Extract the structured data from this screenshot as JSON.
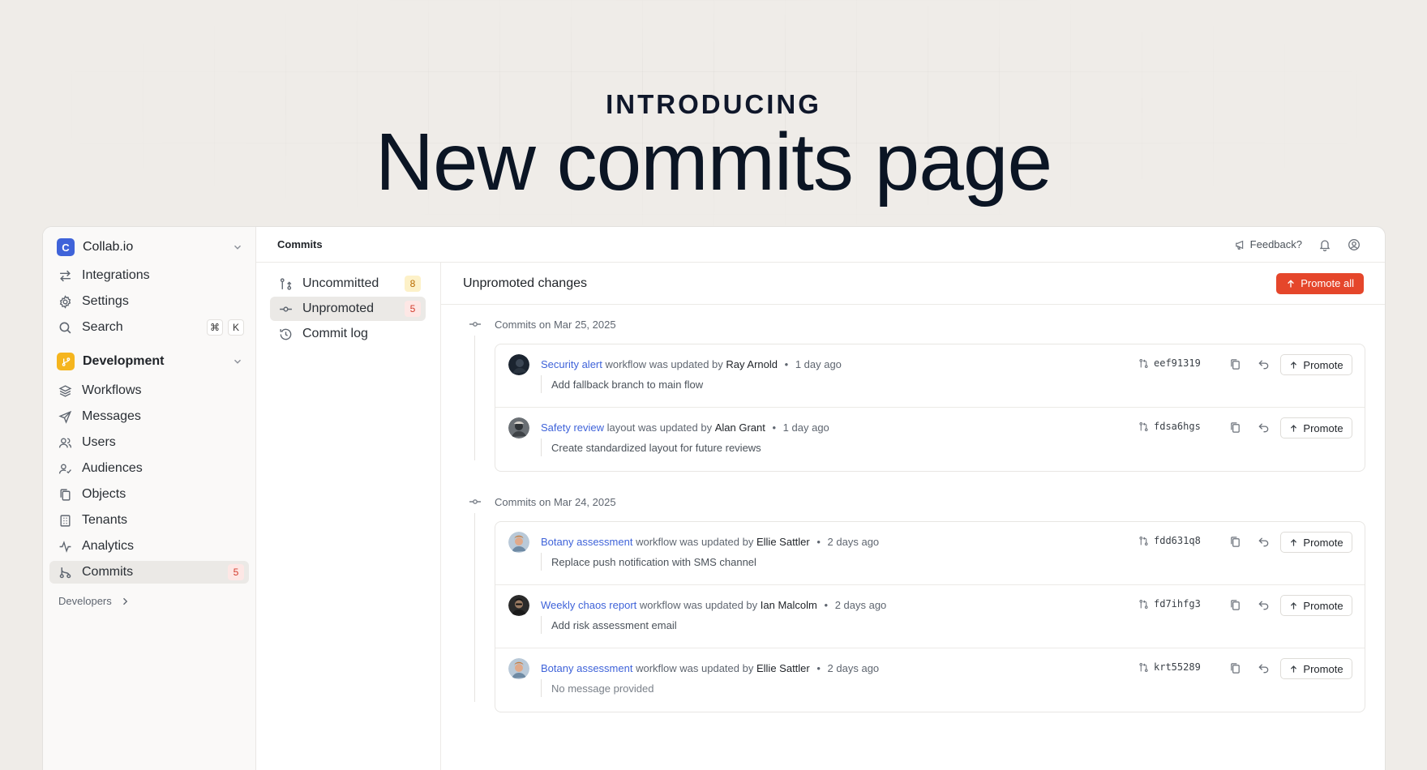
{
  "hero": {
    "kicker": "INTRODUCING",
    "title": "New commits page"
  },
  "sidebar": {
    "org_name": "Collab.io",
    "org_logo_letter": "C",
    "top_items": [
      {
        "label": "Integrations",
        "icon": "arrows-swap-icon"
      },
      {
        "label": "Settings",
        "icon": "gear-icon"
      },
      {
        "label": "Search",
        "icon": "search-icon",
        "shortcut": [
          "⌘",
          "K"
        ]
      }
    ],
    "section_name": "Development",
    "section_items": [
      {
        "label": "Workflows",
        "icon": "layers-icon"
      },
      {
        "label": "Messages",
        "icon": "send-icon"
      },
      {
        "label": "Users",
        "icon": "users-icon"
      },
      {
        "label": "Audiences",
        "icon": "audience-icon"
      },
      {
        "label": "Objects",
        "icon": "copy-icon"
      },
      {
        "label": "Tenants",
        "icon": "building-icon"
      },
      {
        "label": "Analytics",
        "icon": "activity-icon"
      },
      {
        "label": "Commits",
        "icon": "git-commit-icon",
        "badge": "5",
        "active": true
      }
    ],
    "developers_label": "Developers"
  },
  "topbar": {
    "title": "Commits",
    "feedback_label": "Feedback?"
  },
  "subnav": [
    {
      "label": "Uncommitted",
      "badge": "8"
    },
    {
      "label": "Unpromoted",
      "badge": "5",
      "active": true
    },
    {
      "label": "Commit log"
    }
  ],
  "content": {
    "title": "Unpromoted changes",
    "promote_all_label": "Promote all",
    "promote_label": "Promote",
    "groups": [
      {
        "date_label": "Commits on Mar 25, 2025",
        "commits": [
          {
            "resource": "Security alert",
            "kind": "workflow",
            "verb": "was updated by",
            "author": "Ray Arnold",
            "time": "1 day ago",
            "message": "Add fallback branch to main flow",
            "sha": "eef91319"
          },
          {
            "resource": "Safety review",
            "kind": "layout",
            "verb": "was updated by",
            "author": "Alan Grant",
            "time": "1 day ago",
            "message": "Create standardized layout for future reviews",
            "sha": "fdsa6hgs"
          }
        ]
      },
      {
        "date_label": "Commits on Mar 24, 2025",
        "commits": [
          {
            "resource": "Botany assessment",
            "kind": "workflow",
            "verb": "was updated by",
            "author": "Ellie Sattler",
            "time": "2 days ago",
            "message": "Replace push notification with SMS channel",
            "sha": "fdd631q8"
          },
          {
            "resource": "Weekly chaos report",
            "kind": "workflow",
            "verb": "was updated by",
            "author": "Ian Malcolm",
            "time": "2 days ago",
            "message": "Add risk assessment email",
            "sha": "fd7ihfg3"
          },
          {
            "resource": "Botany assessment",
            "kind": "workflow",
            "verb": "was updated by",
            "author": "Ellie Sattler",
            "time": "2 days ago",
            "message": "No message provided",
            "sha": "krt55289"
          }
        ]
      }
    ]
  },
  "colors": {
    "accent_blue": "#3f63d9",
    "promote_red": "#e5462b",
    "dev_yellow": "#f5b51e"
  }
}
